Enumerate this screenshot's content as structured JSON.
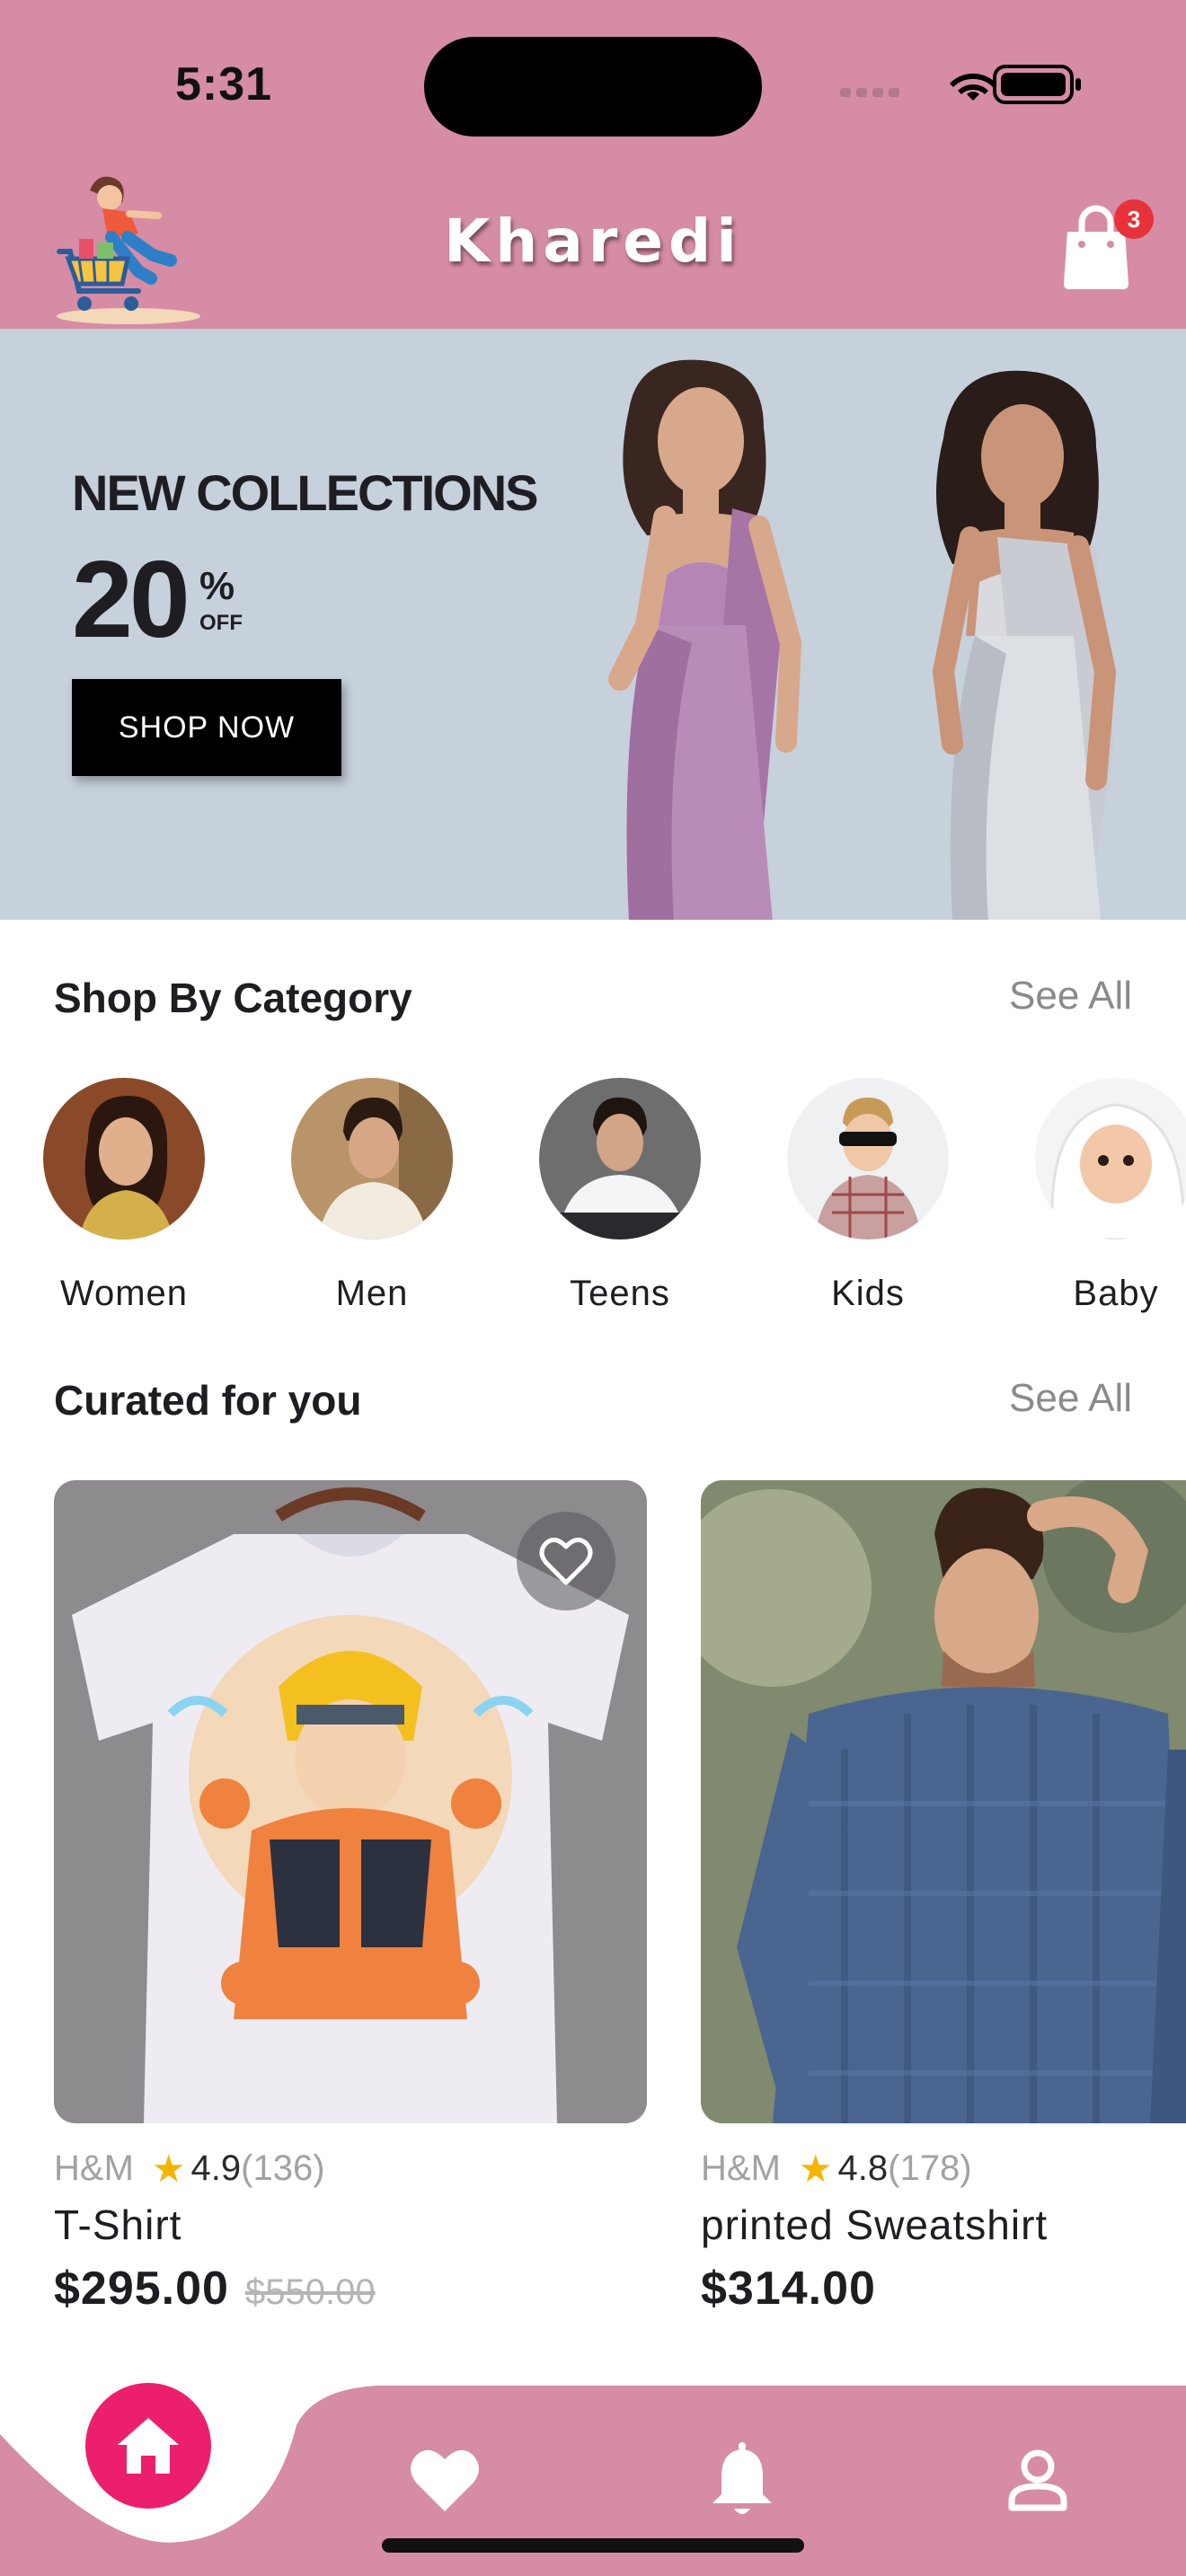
{
  "status_bar": {
    "time": "5:31"
  },
  "header": {
    "brand": "Kharedi",
    "cart_count": "3"
  },
  "banner": {
    "title": "NEW COLLECTIONS",
    "discount": "20",
    "percent": "%",
    "off": "OFF",
    "cta": "SHOP NOW"
  },
  "categories_section": {
    "title": "Shop By Category",
    "see_all": "See All",
    "items": [
      {
        "label": "Women"
      },
      {
        "label": "Men"
      },
      {
        "label": "Teens"
      },
      {
        "label": "Kids"
      },
      {
        "label": "Baby"
      }
    ]
  },
  "curated_section": {
    "title": "Curated for you",
    "see_all": "See All",
    "products": [
      {
        "brand": "H&M",
        "rating": "4.9",
        "reviews": "(136)",
        "name": "T-Shirt",
        "price": "$295.00",
        "old_price": "$550.00"
      },
      {
        "brand": "H&M",
        "rating": "4.8",
        "reviews": "(178)",
        "name": "printed Sweatshirt",
        "price": "$314.00",
        "old_price": ""
      }
    ]
  },
  "bottom_nav": {
    "items": [
      {
        "icon": "home-icon",
        "active": true
      },
      {
        "icon": "heart-icon",
        "active": false
      },
      {
        "icon": "bell-icon",
        "active": false
      },
      {
        "icon": "profile-icon",
        "active": false
      }
    ]
  },
  "colors": {
    "header_bg": "#d68ca4",
    "banner_bg": "#c6d1dc",
    "accent": "#ec1f6c",
    "badge": "#e8323a",
    "star": "#f4b400"
  }
}
